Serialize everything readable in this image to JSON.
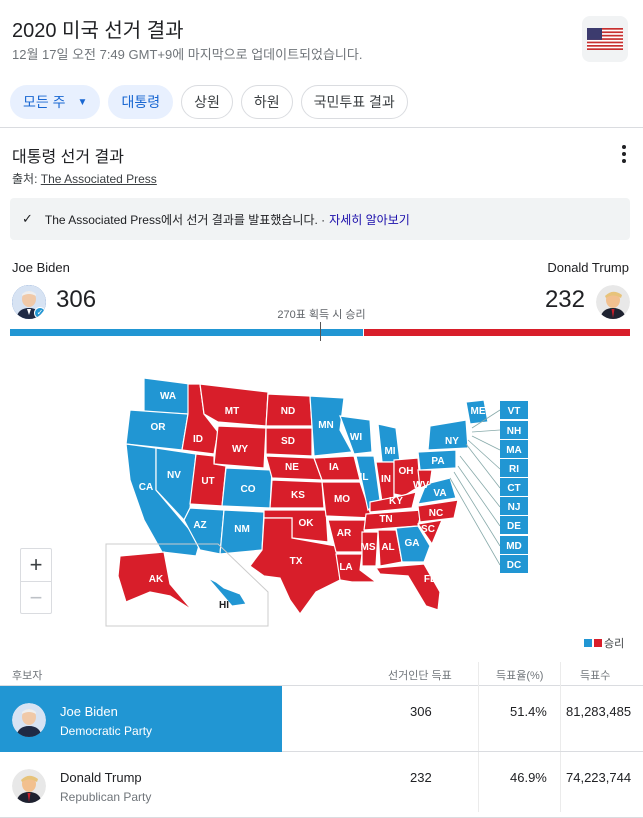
{
  "header": {
    "title": "2020 미국 선거 결과",
    "updated": "12월 17일 오전 7:49 GMT+9에 마지막으로 업데이트되었습니다.",
    "flag_icon": "us-flag-icon"
  },
  "chips": [
    {
      "label": "모든 주",
      "selected": true
    },
    {
      "label": "대통령",
      "selected": true
    },
    {
      "label": "상원",
      "selected": false
    },
    {
      "label": "하원",
      "selected": false
    },
    {
      "label": "국민투표 결과",
      "selected": false
    }
  ],
  "section": {
    "title": "대통령 선거 결과",
    "source_prefix": "출처: ",
    "source_link": "The Associated Press"
  },
  "notice": {
    "text": "The Associated Press에서 선거 결과를 발표했습니다. ·",
    "more": "자세히 알아보기"
  },
  "race": {
    "left_name": "Joe Biden",
    "left_votes": "306",
    "right_name": "Donald Trump",
    "right_votes": "232",
    "threshold": "270표 획득 시 승리",
    "dem_share": 0.569
  },
  "map": {
    "states": [
      "WA",
      "OR",
      "CA",
      "NV",
      "ID",
      "MT",
      "WY",
      "UT",
      "AZ",
      "CO",
      "NM",
      "ND",
      "SD",
      "NE",
      "KS",
      "OK",
      "TX",
      "MN",
      "IA",
      "MO",
      "AR",
      "LA",
      "WI",
      "IL",
      "MI",
      "IN",
      "OH",
      "KY",
      "TN",
      "MS",
      "AL",
      "GA",
      "FL",
      "SC",
      "NC",
      "VA",
      "WV",
      "PA",
      "NY",
      "ME",
      "AK",
      "HI"
    ],
    "small_states": [
      "VT",
      "NH",
      "MA",
      "RI",
      "CT",
      "NJ",
      "DE",
      "MD",
      "DC"
    ]
  },
  "legend": {
    "label": "승리"
  },
  "colors": {
    "dem": "#2196d3",
    "rep": "#d81e2a"
  },
  "table": {
    "headers": {
      "candidate": "후보자",
      "electoral": "선거인단 득표",
      "percent": "득표율(%)",
      "votes": "득표수"
    },
    "rows": [
      {
        "name": "Joe Biden",
        "party": "Democratic Party",
        "electoral": "306",
        "percent": "51.4%",
        "votes": "81,283,485",
        "winner": true
      },
      {
        "name": "Donald Trump",
        "party": "Republican Party",
        "electoral": "232",
        "percent": "46.9%",
        "votes": "74,223,744",
        "winner": false
      }
    ]
  }
}
